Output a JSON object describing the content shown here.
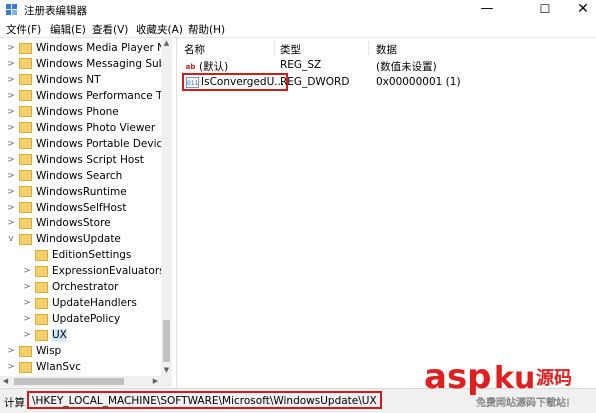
{
  "window": {
    "title": "注册表编辑器",
    "min_glyph": "—",
    "max_glyph": "☐",
    "close_glyph": "✕"
  },
  "menu": [
    "文件(F)",
    "编辑(E)",
    "查看(V)",
    "收藏夹(A)",
    "帮助(H)"
  ],
  "tree": {
    "items": [
      {
        "label": "Windows Media Player NS",
        "expand": ">"
      },
      {
        "label": "Windows Messaging Subs",
        "expand": ">"
      },
      {
        "label": "Windows NT",
        "expand": ">"
      },
      {
        "label": "Windows Performance Too",
        "expand": ">"
      },
      {
        "label": "Windows Phone",
        "expand": ">"
      },
      {
        "label": "Windows Photo Viewer",
        "expand": ">"
      },
      {
        "label": "Windows Portable Devices",
        "expand": ">"
      },
      {
        "label": "Windows Script Host",
        "expand": ">"
      },
      {
        "label": "Windows Search",
        "expand": ">"
      },
      {
        "label": "WindowsRuntime",
        "expand": ">"
      },
      {
        "label": "WindowsSelfHost",
        "expand": ">"
      },
      {
        "label": "WindowsStore",
        "expand": ">"
      },
      {
        "label": "WindowsUpdate",
        "expand": "v"
      },
      {
        "label": "EditionSettings",
        "expand": ""
      },
      {
        "label": "ExpressionEvaluators",
        "expand": ">"
      },
      {
        "label": "Orchestrator",
        "expand": ">"
      },
      {
        "label": "UpdateHandlers",
        "expand": ">"
      },
      {
        "label": "UpdatePolicy",
        "expand": ">"
      },
      {
        "label": "UX",
        "expand": ">",
        "selected": true
      },
      {
        "label": "Wisp",
        "expand": ">"
      },
      {
        "label": "WlanSvc",
        "expand": ">"
      }
    ]
  },
  "list": {
    "headers": {
      "name": "名称",
      "type": "类型",
      "data": "数据"
    },
    "rows": [
      {
        "icon": "string-value-icon",
        "icon_text": "ab",
        "name": "(默认)",
        "type": "REG_SZ",
        "data": "(数值未设置)"
      },
      {
        "icon": "dword-value-icon",
        "icon_text": "011",
        "name": "IsConvergedU...",
        "type": "REG_DWORD",
        "data": "0x00000001 (1)",
        "selected": true
      }
    ]
  },
  "status": {
    "label": "计算",
    "path": "\\HKEY_LOCAL_MACHINE\\SOFTWARE\\Microsoft\\WindowsUpdate\\UX"
  },
  "watermark": {
    "logo_main": "asp",
    "logo_ku": "ku",
    "logo_cn": "源码",
    "tagline": "免费网站源码下载站!"
  },
  "colors": {
    "highlight_red": "#d01c1c",
    "selection": "#cce8ff",
    "folder": "#f4d06b",
    "watermark_red": "#e02020"
  }
}
